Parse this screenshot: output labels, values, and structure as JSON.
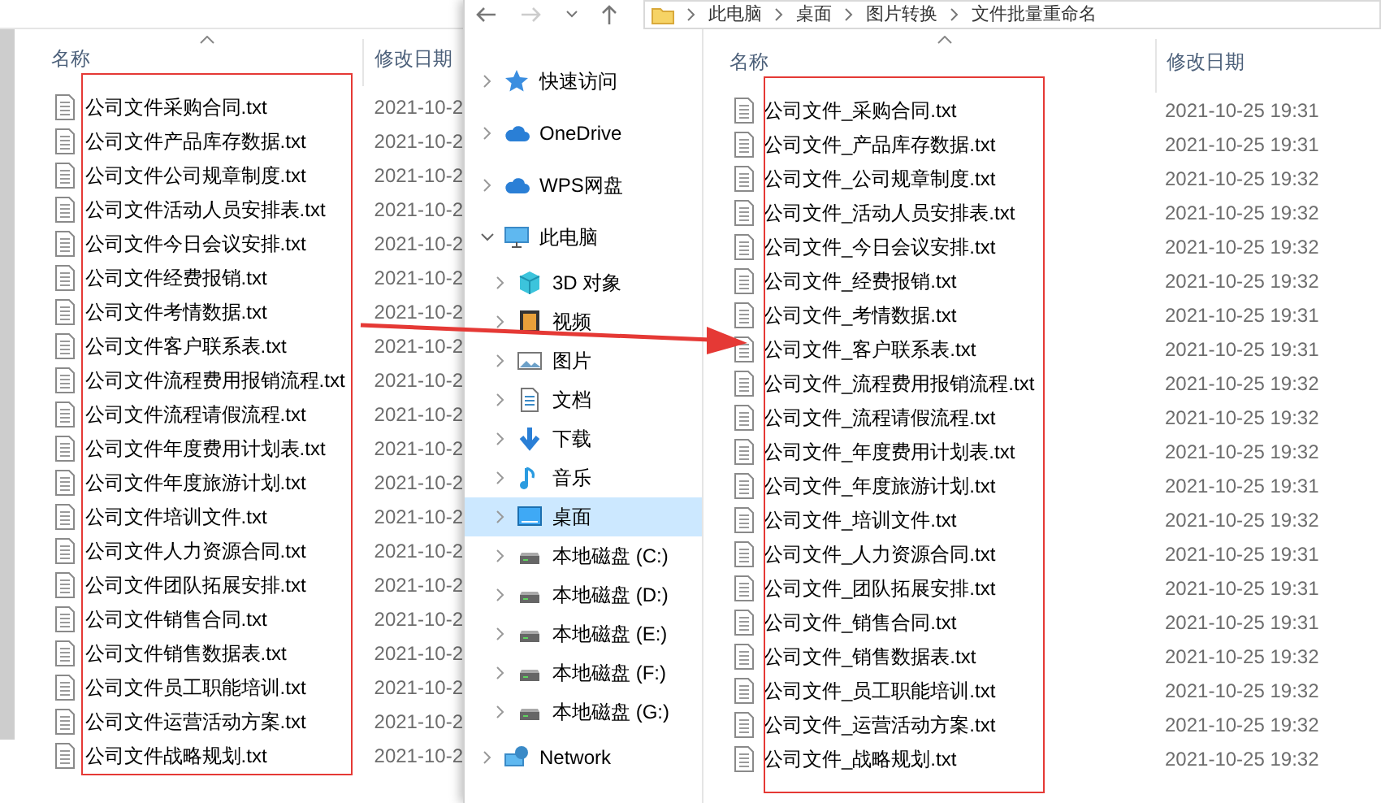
{
  "left_window": {
    "columns": [
      "名称",
      "修改日期"
    ],
    "files": [
      {
        "name": "公司文件采购合同.txt",
        "date": "2021-10-2"
      },
      {
        "name": "公司文件产品库存数据.txt",
        "date": "2021-10-2"
      },
      {
        "name": "公司文件公司规章制度.txt",
        "date": "2021-10-2"
      },
      {
        "name": "公司文件活动人员安排表.txt",
        "date": "2021-10-2"
      },
      {
        "name": "公司文件今日会议安排.txt",
        "date": "2021-10-2"
      },
      {
        "name": "公司文件经费报销.txt",
        "date": "2021-10-2"
      },
      {
        "name": "公司文件考情数据.txt",
        "date": "2021-10-2"
      },
      {
        "name": "公司文件客户联系表.txt",
        "date": "2021-10-2"
      },
      {
        "name": "公司文件流程费用报销流程.txt",
        "date": "2021-10-2"
      },
      {
        "name": "公司文件流程请假流程.txt",
        "date": "2021-10-2"
      },
      {
        "name": "公司文件年度费用计划表.txt",
        "date": "2021-10-2"
      },
      {
        "name": "公司文件年度旅游计划.txt",
        "date": "2021-10-2"
      },
      {
        "name": "公司文件培训文件.txt",
        "date": "2021-10-2"
      },
      {
        "name": "公司文件人力资源合同.txt",
        "date": "2021-10-2"
      },
      {
        "name": "公司文件团队拓展安排.txt",
        "date": "2021-10-2"
      },
      {
        "name": "公司文件销售合同.txt",
        "date": "2021-10-2"
      },
      {
        "name": "公司文件销售数据表.txt",
        "date": "2021-10-2"
      },
      {
        "name": "公司文件员工职能培训.txt",
        "date": "2021-10-2"
      },
      {
        "name": "公司文件运营活动方案.txt",
        "date": "2021-10-2"
      },
      {
        "name": "公司文件战略规划.txt",
        "date": "2021-10-2"
      }
    ]
  },
  "right_window": {
    "breadcrumb": [
      "此电脑",
      "桌面",
      "图片转换",
      "文件批量重命名"
    ],
    "nav": [
      {
        "label": "快速访问",
        "kind": "star",
        "expanded": false,
        "selected": false
      },
      {
        "label": "OneDrive",
        "kind": "cloud",
        "expanded": false,
        "selected": false
      },
      {
        "label": "WPS网盘",
        "kind": "cloud",
        "expanded": false,
        "selected": false
      },
      {
        "label": "此电脑",
        "kind": "pc",
        "expanded": true,
        "selected": false,
        "children": [
          {
            "label": "3D 对象",
            "kind": "cube",
            "expanded": false,
            "selected": false
          },
          {
            "label": "视频",
            "kind": "video",
            "expanded": false,
            "selected": false
          },
          {
            "label": "图片",
            "kind": "picture",
            "expanded": false,
            "selected": false
          },
          {
            "label": "文档",
            "kind": "doc",
            "expanded": false,
            "selected": false
          },
          {
            "label": "下载",
            "kind": "download",
            "expanded": false,
            "selected": false
          },
          {
            "label": "音乐",
            "kind": "music",
            "expanded": false,
            "selected": false
          },
          {
            "label": "桌面",
            "kind": "desktop",
            "expanded": false,
            "selected": true
          },
          {
            "label": "本地磁盘 (C:)",
            "kind": "drive",
            "expanded": false,
            "selected": false
          },
          {
            "label": "本地磁盘 (D:)",
            "kind": "drive",
            "expanded": false,
            "selected": false
          },
          {
            "label": "本地磁盘 (E:)",
            "kind": "drive",
            "expanded": false,
            "selected": false
          },
          {
            "label": "本地磁盘 (F:)",
            "kind": "drive",
            "expanded": false,
            "selected": false
          },
          {
            "label": "本地磁盘 (G:)",
            "kind": "drive",
            "expanded": false,
            "selected": false
          }
        ]
      },
      {
        "label": "Network",
        "kind": "network",
        "expanded": false,
        "selected": false
      }
    ],
    "columns": [
      "名称",
      "修改日期"
    ],
    "files": [
      {
        "name": "公司文件_采购合同.txt",
        "date": "2021-10-25 19:31"
      },
      {
        "name": "公司文件_产品库存数据.txt",
        "date": "2021-10-25 19:31"
      },
      {
        "name": "公司文件_公司规章制度.txt",
        "date": "2021-10-25 19:32"
      },
      {
        "name": "公司文件_活动人员安排表.txt",
        "date": "2021-10-25 19:32"
      },
      {
        "name": "公司文件_今日会议安排.txt",
        "date": "2021-10-25 19:32"
      },
      {
        "name": "公司文件_经费报销.txt",
        "date": "2021-10-25 19:32"
      },
      {
        "name": "公司文件_考情数据.txt",
        "date": "2021-10-25 19:31"
      },
      {
        "name": "公司文件_客户联系表.txt",
        "date": "2021-10-25 19:31"
      },
      {
        "name": "公司文件_流程费用报销流程.txt",
        "date": "2021-10-25 19:32"
      },
      {
        "name": "公司文件_流程请假流程.txt",
        "date": "2021-10-25 19:32"
      },
      {
        "name": "公司文件_年度费用计划表.txt",
        "date": "2021-10-25 19:32"
      },
      {
        "name": "公司文件_年度旅游计划.txt",
        "date": "2021-10-25 19:31"
      },
      {
        "name": "公司文件_培训文件.txt",
        "date": "2021-10-25 19:32"
      },
      {
        "name": "公司文件_人力资源合同.txt",
        "date": "2021-10-25 19:31"
      },
      {
        "name": "公司文件_团队拓展安排.txt",
        "date": "2021-10-25 19:31"
      },
      {
        "name": "公司文件_销售合同.txt",
        "date": "2021-10-25 19:31"
      },
      {
        "name": "公司文件_销售数据表.txt",
        "date": "2021-10-25 19:32"
      },
      {
        "name": "公司文件_员工职能培训.txt",
        "date": "2021-10-25 19:32"
      },
      {
        "name": "公司文件_运营活动方案.txt",
        "date": "2021-10-25 19:32"
      },
      {
        "name": "公司文件_战略规划.txt",
        "date": "2021-10-25 19:32"
      }
    ]
  }
}
